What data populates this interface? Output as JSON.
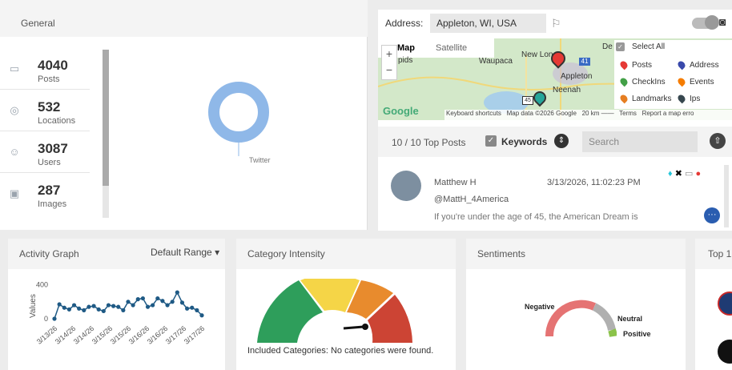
{
  "general": {
    "title": "General",
    "stats": [
      {
        "value": "4040",
        "label": "Posts",
        "icon": "posts-icon"
      },
      {
        "value": "532",
        "label": "Locations",
        "icon": "location-icon"
      },
      {
        "value": "3087",
        "label": "Users",
        "icon": "users-icon"
      },
      {
        "value": "287",
        "label": "Images",
        "icon": "images-icon"
      }
    ],
    "donut_label": "Twitter"
  },
  "map": {
    "address_label": "Address:",
    "address_value": "Appleton, WI, USA",
    "tab_map": "Map",
    "tab_satellite": "Satellite",
    "place_labels": [
      "Waupaca",
      "New Lon",
      "Appleton",
      "Neenah",
      "pids",
      "De"
    ],
    "road_labels": [
      "41",
      "45"
    ],
    "legend": {
      "select_all": "Select All",
      "items": [
        {
          "label": "Posts",
          "color": "#e53935"
        },
        {
          "label": "Address",
          "color": "#3949ab"
        },
        {
          "label": "CheckIns",
          "color": "#43a047"
        },
        {
          "label": "Events",
          "color": "#f57c00"
        },
        {
          "label": "Landmarks",
          "color": "#e67e22"
        },
        {
          "label": "Ips",
          "color": "#37474f"
        }
      ]
    },
    "footer": {
      "shortcuts": "Keyboard shortcuts",
      "data": "Map data ©2026 Google",
      "scale": "20 km",
      "terms": "Terms",
      "report": "Report a map erro"
    },
    "google": "Google"
  },
  "posts": {
    "count": "10 / 10 Top Posts",
    "keywords": "Keywords",
    "search_placeholder": "Search",
    "item": {
      "author": "Matthew H",
      "handle": "@MattH_4America",
      "time": "3/13/2026, 11:02:23 PM",
      "text": "If you're under the age of 45, the American Dream is"
    }
  },
  "activity": {
    "title": "Activity Graph",
    "range": "Default Range"
  },
  "category": {
    "title": "Category Intensity",
    "note": "Included Categories: No categories were found."
  },
  "sentiments": {
    "title": "Sentiments",
    "labels": [
      "Negative",
      "Neutral",
      "Positive"
    ]
  },
  "top": {
    "title": "Top 1"
  },
  "chart_data": {
    "type": "line",
    "ylabel": "Values",
    "yticks": [
      0,
      400
    ],
    "ylim": [
      0,
      500
    ],
    "x_tick_labels": [
      "3/13/26",
      "3/14/26",
      "3/14/26",
      "3/15/26",
      "3/15/26",
      "3/16/26",
      "3/16/26",
      "3/17/26",
      "3/17/26"
    ],
    "values": [
      0,
      170,
      130,
      110,
      160,
      120,
      100,
      140,
      150,
      110,
      90,
      160,
      150,
      140,
      100,
      200,
      160,
      230,
      240,
      140,
      160,
      240,
      210,
      160,
      200,
      310,
      190,
      120,
      130,
      100,
      40
    ]
  }
}
